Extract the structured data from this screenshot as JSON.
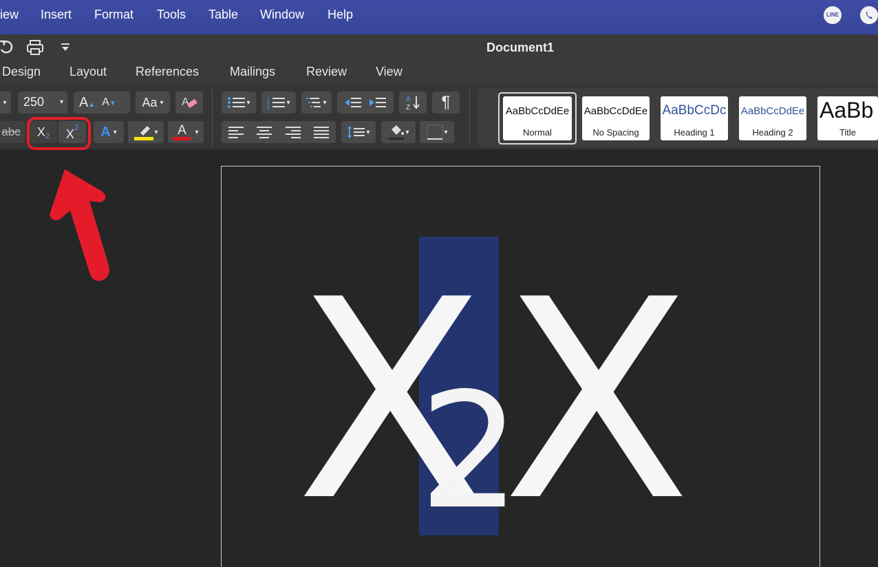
{
  "menubar": {
    "items": [
      "iew",
      "Insert",
      "Format",
      "Tools",
      "Table",
      "Window",
      "Help"
    ],
    "tray": [
      "LINE",
      ""
    ]
  },
  "titlebar": {
    "title": "Document1"
  },
  "tabs": [
    "Design",
    "Layout",
    "References",
    "Mailings",
    "Review",
    "View"
  ],
  "ribbon": {
    "font_size": "250",
    "subscript_label": "X",
    "subscript_sub": "2",
    "superscript_label": "X",
    "superscript_sup": "2",
    "strikethrough_label": "abc",
    "grow_font": "A",
    "shrink_font": "A",
    "change_case": "Aa",
    "text_effects": "A",
    "font_color": "A",
    "pilcrow": "¶",
    "highlight_color": "#f5e60a",
    "font_color_value": "#e0141e"
  },
  "styles": [
    {
      "sample": "AaBbCcDdEe",
      "name": "Normal"
    },
    {
      "sample": "AaBbCcDdEe",
      "name": "No Spacing"
    },
    {
      "sample": "AaBbCcDc",
      "name": "Heading 1"
    },
    {
      "sample": "AaBbCcDdEe",
      "name": "Heading 2"
    },
    {
      "sample": "AaBb",
      "name": "Title"
    }
  ],
  "document": {
    "text_left": "X",
    "text_sub": "2",
    "text_right": "X",
    "selection_color": "#24346e"
  },
  "annotation": {
    "color": "#e41c2a"
  }
}
